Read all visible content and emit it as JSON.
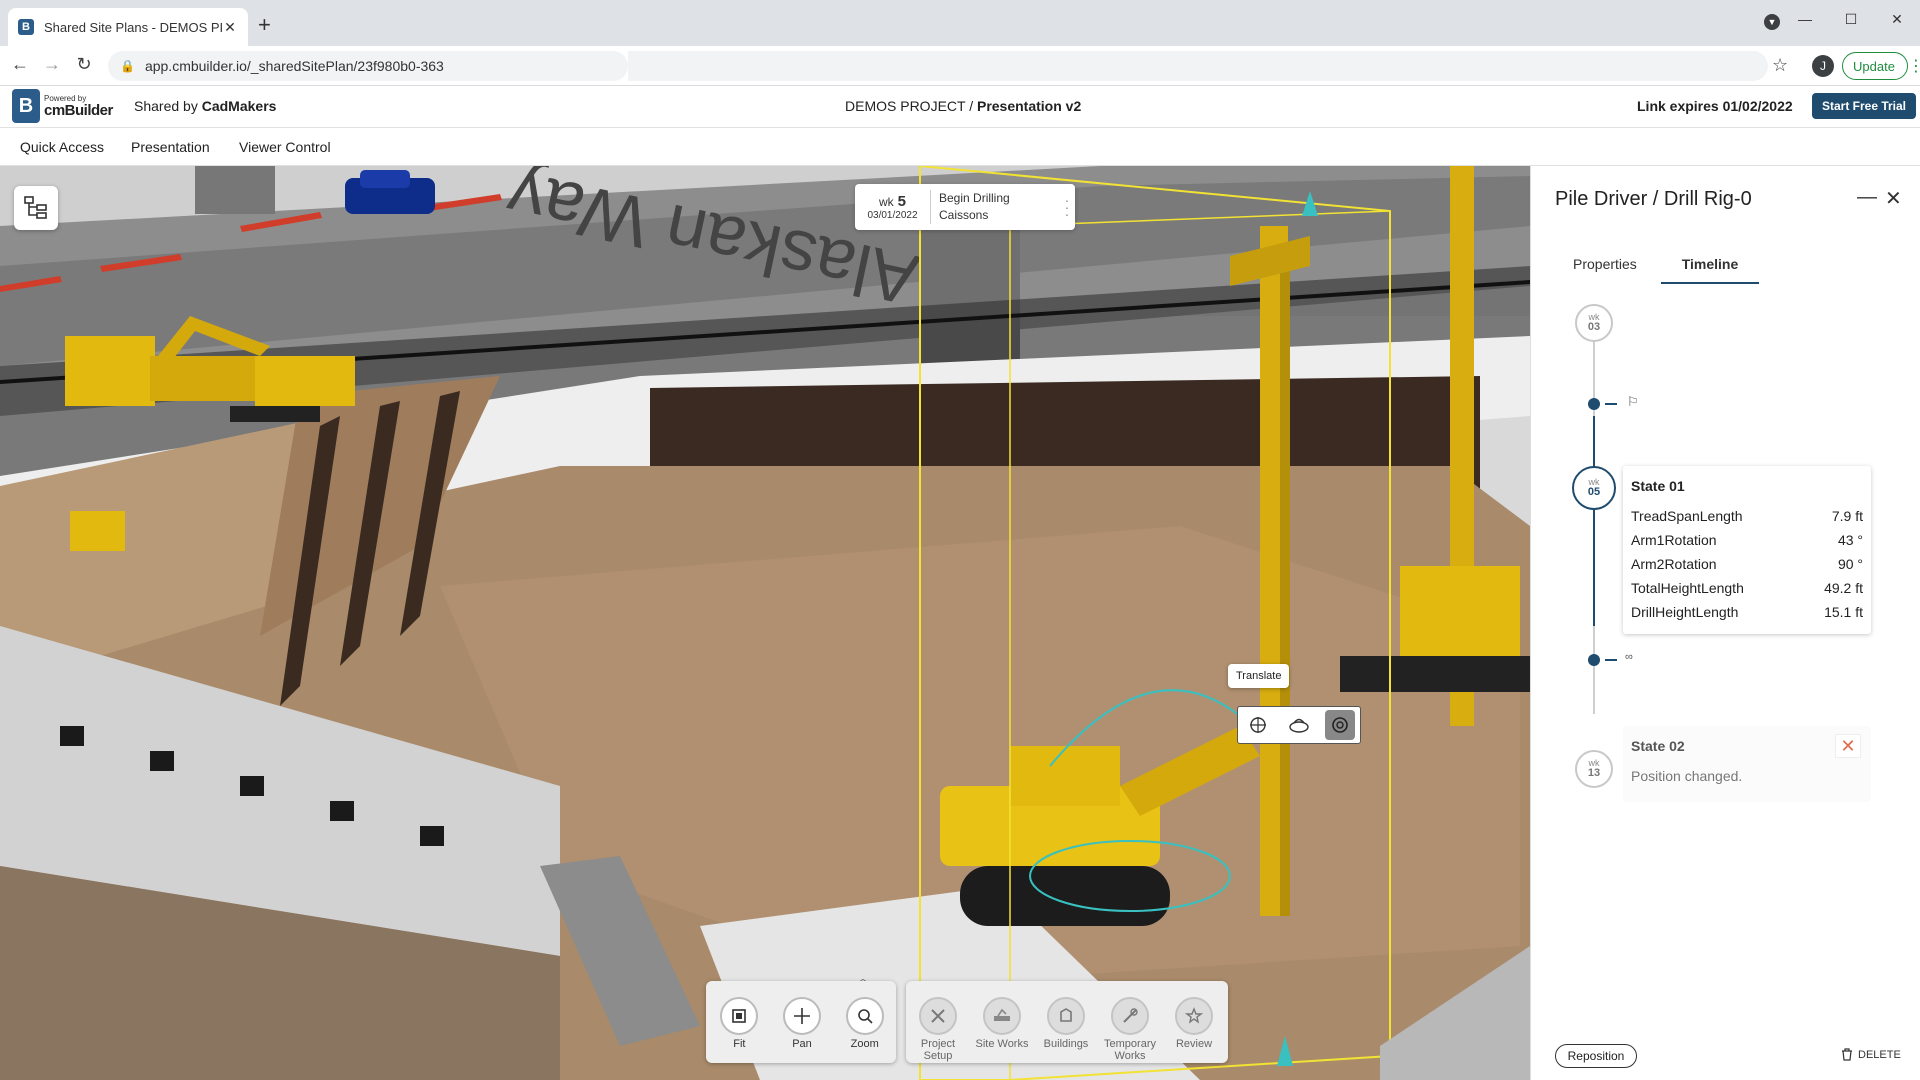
{
  "browser": {
    "tab_title": "Shared Site Plans - DEMOS PROJ",
    "tab_favicon": "B",
    "tab_close": "✕",
    "new_tab": "+",
    "url": "app.cmbuilder.io/_sharedSitePlan/23f980b0-363",
    "profile_initial": "J",
    "update_label": "Update",
    "window_controls": {
      "minimize": "—",
      "maximize": "☐",
      "close": "✕"
    }
  },
  "header": {
    "powered_by": "Powered by",
    "brand": "cmBuilder",
    "logo_letter": "B",
    "shared_by_prefix": "Shared by",
    "shared_by_name": "CadMakers",
    "project": "DEMOS PROJECT /",
    "presentation": "Presentation v2",
    "link_expires": "Link expires 01/02/2022",
    "trial_button": "Start Free Trial"
  },
  "nav": {
    "items": [
      "Quick Access",
      "Presentation",
      "Viewer Control"
    ]
  },
  "viewport": {
    "week_card": {
      "wk_label": "wk",
      "wk_number": "5",
      "date": "03/01/2022",
      "task_line1": "Begin Drilling",
      "task_line2": "Caissons"
    },
    "tooltip": "Translate",
    "scene_text": "Alaskan Way",
    "toolbar_left": [
      {
        "label": "Fit",
        "icon": "fit-icon"
      },
      {
        "label": "Pan",
        "icon": "pan-icon"
      },
      {
        "label": "Zoom",
        "icon": "zoom-icon"
      }
    ],
    "toolbar_right": [
      {
        "label": "Project Setup",
        "icon": "project-setup-icon"
      },
      {
        "label": "Site Works",
        "icon": "site-works-icon"
      },
      {
        "label": "Buildings",
        "icon": "buildings-icon"
      },
      {
        "label": "Temporary Works",
        "icon": "temporary-works-icon"
      },
      {
        "label": "Review",
        "icon": "review-icon"
      }
    ]
  },
  "panel": {
    "title": "Pile Driver / Drill Rig-0",
    "tabs": [
      "Properties",
      "Timeline"
    ],
    "active_tab": "Timeline",
    "timeline": {
      "weeks": [
        {
          "wk": "wk",
          "num": "03"
        },
        {
          "wk": "wk",
          "num": "05"
        },
        {
          "wk": "wk",
          "num": "13"
        }
      ],
      "state1": {
        "name": "State 01",
        "properties": [
          {
            "name": "TreadSpanLength",
            "value": "7.9 ft"
          },
          {
            "name": "Arm1Rotation",
            "value": "43 °"
          },
          {
            "name": "Arm2Rotation",
            "value": "90 °"
          },
          {
            "name": "TotalHeightLength",
            "value": "49.2 ft"
          },
          {
            "name": "DrillHeightLength",
            "value": "15.1 ft"
          }
        ]
      },
      "state2": {
        "name": "State 02",
        "description": "Position changed."
      }
    },
    "reposition_label": "Reposition",
    "delete_label": "DELETE"
  },
  "colors": {
    "brand_dark": "#1e4b6e",
    "machine_yellow": "#e2b90f",
    "dirt": "#a98a6a",
    "delete_red": "#e06a4e",
    "update_green": "#1e8e3e"
  }
}
